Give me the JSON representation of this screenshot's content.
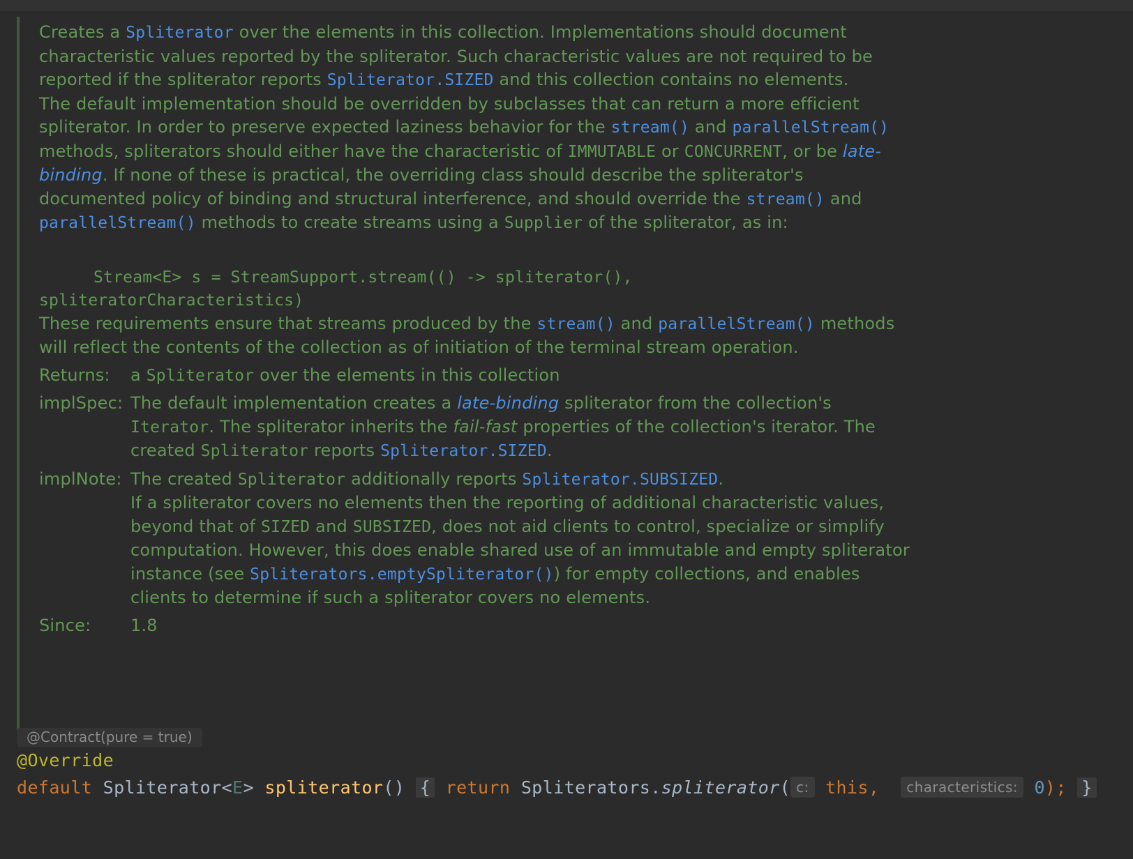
{
  "doc": {
    "p1": {
      "t1": "Creates a ",
      "c1": "Spliterator",
      "t2": " over the elements in this collection. Implementations should document characteristic values reported by the spliterator. Such characteristic values are not required to be reported if the spliterator reports ",
      "c2": "Spliterator.SIZED",
      "t3": " and this collection contains no elements."
    },
    "p2": {
      "t1": "The default implementation should be overridden by subclasses that can return a more efficient spliterator. In order to preserve expected laziness behavior for the ",
      "l1": "stream()",
      "t2": " and ",
      "l2": "parallelStream()",
      "t3": " methods, spliterators should either have the characteristic of ",
      "m1": "IMMUTABLE",
      "t4": " or ",
      "m2": "CONCURRENT",
      "t5": ", or be ",
      "i1": "late-binding",
      "t6": ". If none of these is practical, the overriding class should describe the spliterator's documented policy of binding and structural interference, and should override the ",
      "l3": "stream()",
      "t7": " and ",
      "l4": "parallelStream()",
      "t8": " methods to create streams using a ",
      "m3": "Supplier",
      "t9": " of the spliterator, as in:"
    },
    "code_sample": {
      "line1": "Stream<E> s = StreamSupport.stream(() -> spliterator(),",
      "line2": "spliteratorCharacteristics)"
    },
    "p3": {
      "t1": "These requirements ensure that streams produced by the ",
      "l1": "stream()",
      "t2": " and ",
      "l2": "parallelStream()",
      "t3": " methods will reflect the contents of the collection as of initiation of the terminal stream operation."
    },
    "returns": {
      "label": "Returns:",
      "t1": "a ",
      "m1": "Spliterator",
      "t2": " over the elements in this collection"
    },
    "implspec": {
      "label": "implSpec:",
      "t1": "The default implementation creates a ",
      "i1": "late-binding",
      "t2": " spliterator from the collection's ",
      "m1": "Iterator",
      "t3": ". The spliterator inherits the ",
      "i2": "fail-fast",
      "t4": " properties of the collection's iterator. The created ",
      "m2": "Spliterator",
      "t5": " reports ",
      "l1": "Spliterator.SIZED",
      "t6": "."
    },
    "implnote": {
      "label": "implNote:",
      "t1": "The created ",
      "m1": "Spliterator",
      "t2": " additionally reports ",
      "l1": "Spliterator.SUBSIZED",
      "t3": ".",
      "t4": "If a spliterator covers no elements then the reporting of additional characteristic values, beyond that of ",
      "m2": "SIZED",
      "t5": " and ",
      "m3": "SUBSIZED",
      "t6": ", does not aid clients to control, specialize or simplify computation. However, this does enable shared use of an immutable and empty spliterator instance (see ",
      "l2": "Spliterators.emptySpliterator()",
      "t7": ") for empty collections, and enables clients to determine if such a spliterator covers no elements."
    },
    "since": {
      "label": "Since:",
      "value": "1.8"
    }
  },
  "inferred_annotation": "@Contract(pure = true)",
  "code": {
    "annotation": "@Override",
    "kw_default": "default",
    "type": "Spliterator",
    "lt": "<",
    "type_param": "E",
    "gt": ">",
    "method": "spliterator",
    "parens": "()",
    "fold_open": "{",
    "kw_return": "return",
    "class_ref": "Spliterators.",
    "call": "spliterator",
    "open_paren": "(",
    "hint_c": "c:",
    "kw_this": "this,",
    "hint_characteristics": "characteristics:",
    "zero": "0",
    "close": ");",
    "fold_close": "}"
  },
  "colors": {
    "background": "#2b2b2b",
    "doc_text": "#629755",
    "doc_link": "#4c8ee0",
    "keyword": "#cc7832",
    "annotation": "#bbb529",
    "method_declaration": "#ffc66d",
    "number": "#6897bb",
    "plain": "#a9b7c6"
  }
}
